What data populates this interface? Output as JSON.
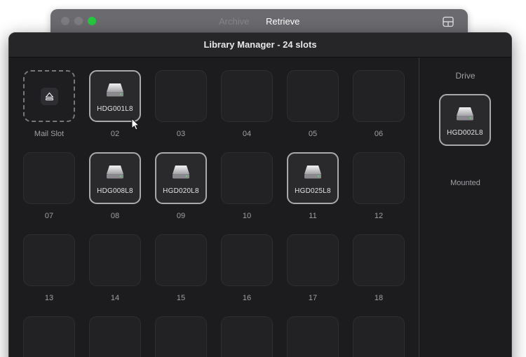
{
  "back_window": {
    "tabs": [
      "Archive",
      "Retrieve"
    ],
    "active_tab": "Retrieve",
    "layout_icon": "layout-panels-icon"
  },
  "window": {
    "title": "Library Manager - 24 slots"
  },
  "slots": [
    {
      "label": "Mail Slot",
      "type": "mail",
      "disk": null
    },
    {
      "label": "02",
      "type": "filled",
      "disk": "HDG001L8"
    },
    {
      "label": "03",
      "type": "empty",
      "disk": null
    },
    {
      "label": "04",
      "type": "empty",
      "disk": null
    },
    {
      "label": "05",
      "type": "empty",
      "disk": null
    },
    {
      "label": "06",
      "type": "empty",
      "disk": null
    },
    {
      "label": "07",
      "type": "empty",
      "disk": null
    },
    {
      "label": "08",
      "type": "filled",
      "disk": "HDG008L8"
    },
    {
      "label": "09",
      "type": "filled",
      "disk": "HGD020L8"
    },
    {
      "label": "10",
      "type": "empty",
      "disk": null
    },
    {
      "label": "11",
      "type": "filled",
      "disk": "HGD025L8"
    },
    {
      "label": "12",
      "type": "empty",
      "disk": null
    },
    {
      "label": "13",
      "type": "empty",
      "disk": null
    },
    {
      "label": "14",
      "type": "empty",
      "disk": null
    },
    {
      "label": "15",
      "type": "empty",
      "disk": null
    },
    {
      "label": "16",
      "type": "empty",
      "disk": null
    },
    {
      "label": "17",
      "type": "empty",
      "disk": null
    },
    {
      "label": "18",
      "type": "empty",
      "disk": null
    },
    {
      "label": "",
      "type": "empty",
      "disk": null
    },
    {
      "label": "",
      "type": "empty",
      "disk": null
    },
    {
      "label": "",
      "type": "empty",
      "disk": null
    },
    {
      "label": "",
      "type": "empty",
      "disk": null
    },
    {
      "label": "",
      "type": "empty",
      "disk": null
    },
    {
      "label": "",
      "type": "empty",
      "disk": null
    }
  ],
  "drive": {
    "heading": "Drive",
    "disk": "HGD002L8",
    "status": "Mounted"
  },
  "colors": {
    "window_bg": "#1c1c1e",
    "slot_border_filled": "#a9a9ad",
    "traffic_green": "#27c840"
  }
}
